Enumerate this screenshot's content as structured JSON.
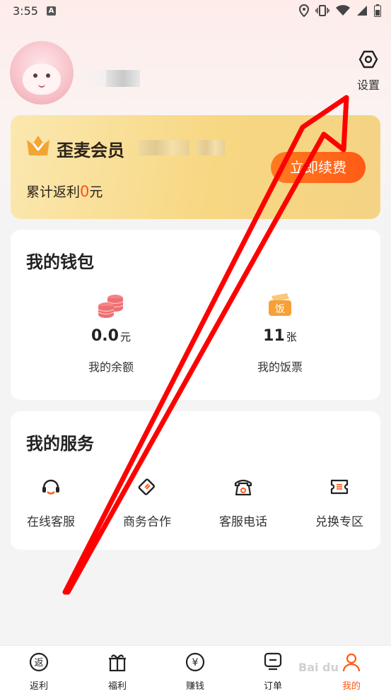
{
  "status_bar": {
    "time": "3:55",
    "a_icon": "A"
  },
  "profile": {
    "settings_label": "设置"
  },
  "vip": {
    "title": "歪麦会员",
    "total_prefix": "累计返利",
    "total_value": "0",
    "total_unit": "元",
    "renew_label": "立即续费"
  },
  "wallet": {
    "title": "我的钱包",
    "balance": {
      "value": "0.0",
      "unit": "元",
      "label": "我的余额",
      "icon": "coin-stack-icon"
    },
    "tickets": {
      "value": "11",
      "unit": "张",
      "label": "我的饭票",
      "icon": "meal-ticket-icon",
      "badge": "饭"
    }
  },
  "services": {
    "title": "我的服务",
    "items": [
      {
        "label": "在线客服",
        "icon": "headset-icon"
      },
      {
        "label": "商务合作",
        "icon": "handshake-icon"
      },
      {
        "label": "客服电话",
        "icon": "phone-icon"
      },
      {
        "label": "兑换专区",
        "icon": "exchange-ticket-icon"
      }
    ]
  },
  "nav": {
    "items": [
      {
        "label": "返利",
        "icon": "rebate-icon",
        "glyph": "返"
      },
      {
        "label": "福利",
        "icon": "gift-icon"
      },
      {
        "label": "赚钱",
        "icon": "yuan-icon",
        "glyph": "¥"
      },
      {
        "label": "订单",
        "icon": "order-icon"
      },
      {
        "label": "我的",
        "icon": "user-icon",
        "active": true
      }
    ]
  },
  "colors": {
    "accent": "#ff5a16",
    "vip_gold": "#f7d782",
    "arrow": "#ff0000"
  }
}
